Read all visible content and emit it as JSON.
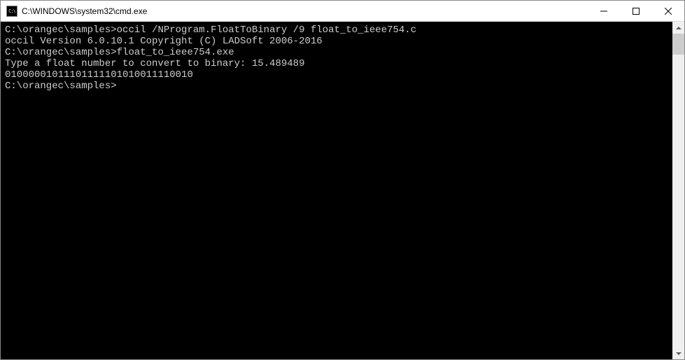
{
  "titlebar": {
    "icon_text": "C:\\",
    "title": "C:\\WINDOWS\\system32\\cmd.exe"
  },
  "console": {
    "prompt1": "C:\\orangec\\samples>",
    "cmd1": "occil /NProgram.FloatToBinary /9 float_to_ieee754.c",
    "out1": "occil Version 6.0.10.1 Copyright (C) LADSoft 2006-2016",
    "blank1": "",
    "prompt2": "C:\\orangec\\samples>",
    "cmd2": "float_to_ieee754.exe",
    "out2": "Type a float number to convert to binary: 15.489489",
    "out3": "01000001011101111101010011110010",
    "blank2": "",
    "prompt3": "C:\\orangec\\samples>"
  }
}
